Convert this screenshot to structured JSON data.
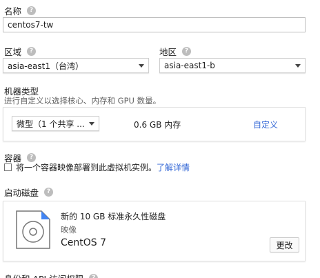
{
  "name": {
    "label": "名称",
    "value": "centos7-tw"
  },
  "region": {
    "label": "区域",
    "value": "asia-east1（台湾）"
  },
  "zone": {
    "label": "地区",
    "value": "asia-east1-b"
  },
  "machine_type": {
    "label": "机器类型",
    "description": "进行自定义以选择核心、内存和 GPU 数量。",
    "cores_value": "微型（1 个共享 ...",
    "memory": "0.6 GB 内存",
    "customize_label": "自定义"
  },
  "container": {
    "label": "容器",
    "checkbox_text": "将一个容器映像部署到此虚拟机实例。",
    "learn_more": "了解详情"
  },
  "boot_disk": {
    "label": "启动磁盘",
    "disk_description": "新的 10 GB 标准永久性磁盘",
    "image_label": "映像",
    "image_name": "CentOS 7",
    "change_button": "更改"
  },
  "identity": {
    "label": "身份和 API 访问权限"
  },
  "help_glyph": "?",
  "colors": {
    "link": "#3367d6",
    "disk_icon": "#4285f4"
  }
}
